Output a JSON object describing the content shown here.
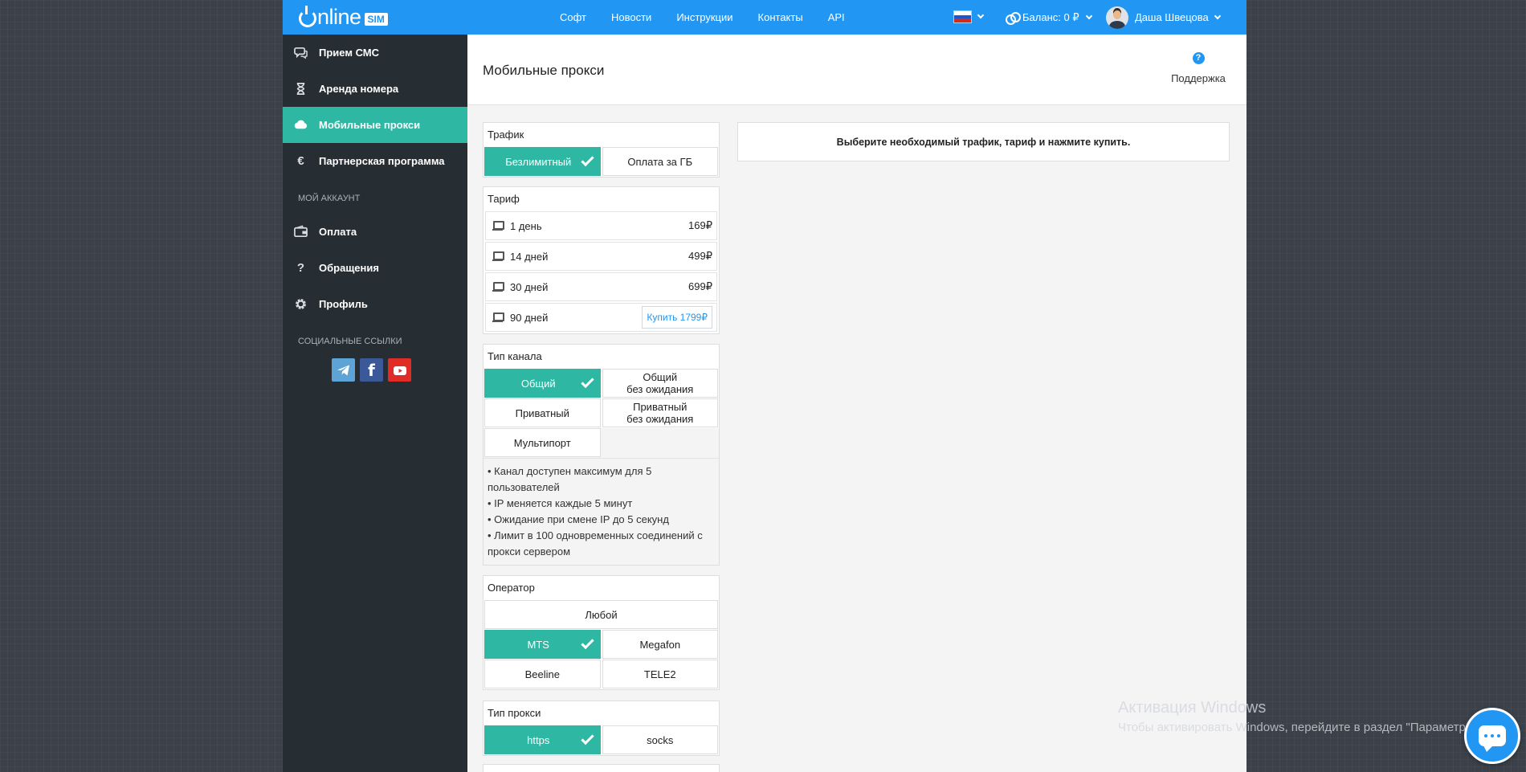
{
  "brand": {
    "logo_text": "nline",
    "logo_badge": "SIM"
  },
  "topnav": [
    "Софт",
    "Новости",
    "Инструкции",
    "Контакты",
    "API"
  ],
  "header": {
    "balance": "Баланс: 0 ₽",
    "user_name": "Даша Швецова"
  },
  "colors": {
    "header_blue": "#2196f3",
    "accent_teal": "#2eb8a3",
    "sidebar_dark": "#262d33"
  },
  "sidebar": {
    "items": [
      {
        "label": "Прием СМС",
        "icon": "chat-icon"
      },
      {
        "label": "Аренда номера",
        "icon": "hourglass-icon"
      },
      {
        "label": "Мобильные прокси",
        "icon": "cloud-icon"
      },
      {
        "label": "Партнерская программа",
        "icon": "euro-icon"
      }
    ],
    "account_heading": "МОЙ АККАУНТ",
    "account_items": [
      {
        "label": "Оплата",
        "icon": "wallet-icon"
      },
      {
        "label": "Обращения",
        "icon": "question-icon"
      },
      {
        "label": "Профиль",
        "icon": "gear-icon"
      }
    ],
    "social_heading": "СОЦИАЛЬНЫЕ ССЫЛКИ"
  },
  "main": {
    "title": "Мобильные прокси",
    "support_label": "Поддержка",
    "notice": "Выберите необходимый трафик, тариф и нажмите купить."
  },
  "traffic": {
    "title": "Трафик",
    "options": [
      "Безлимитный",
      "Оплата за ГБ"
    ],
    "selected": "Безлимитный"
  },
  "tariff": {
    "title": "Тариф",
    "items": [
      {
        "name": "1 день",
        "price": "169₽"
      },
      {
        "name": "14 дней",
        "price": "499₽"
      },
      {
        "name": "30 дней",
        "price": "699₽"
      },
      {
        "name": "90 дней",
        "price": "Купить 1799₽"
      }
    ]
  },
  "channel": {
    "title": "Тип канала",
    "options": [
      "Общий",
      "Общий\nбез ожидания",
      "Приватный",
      "Приватный\nбез ожидания",
      "Мультипорт"
    ],
    "selected": "Общий",
    "description": [
      "• Канал доступен максимум для 5 пользователей",
      "• IP меняется каждые 5 минут",
      "• Ожидание при смене IP до 5 секунд",
      "• Лимит в 100 одновременных соединений с прокси сервером"
    ]
  },
  "operator": {
    "title": "Оператор",
    "options": [
      "Любой",
      "MTS",
      "Megafon",
      "Beeline",
      "TELE2"
    ],
    "selected": "MTS"
  },
  "proxy_type": {
    "title": "Тип прокси",
    "options": [
      "https",
      "socks"
    ],
    "selected": "https"
  },
  "watermark": {
    "line1": "Активация Windows",
    "line2": "Чтобы активировать Windows, перейдите в раздел \"Параметры\"."
  }
}
